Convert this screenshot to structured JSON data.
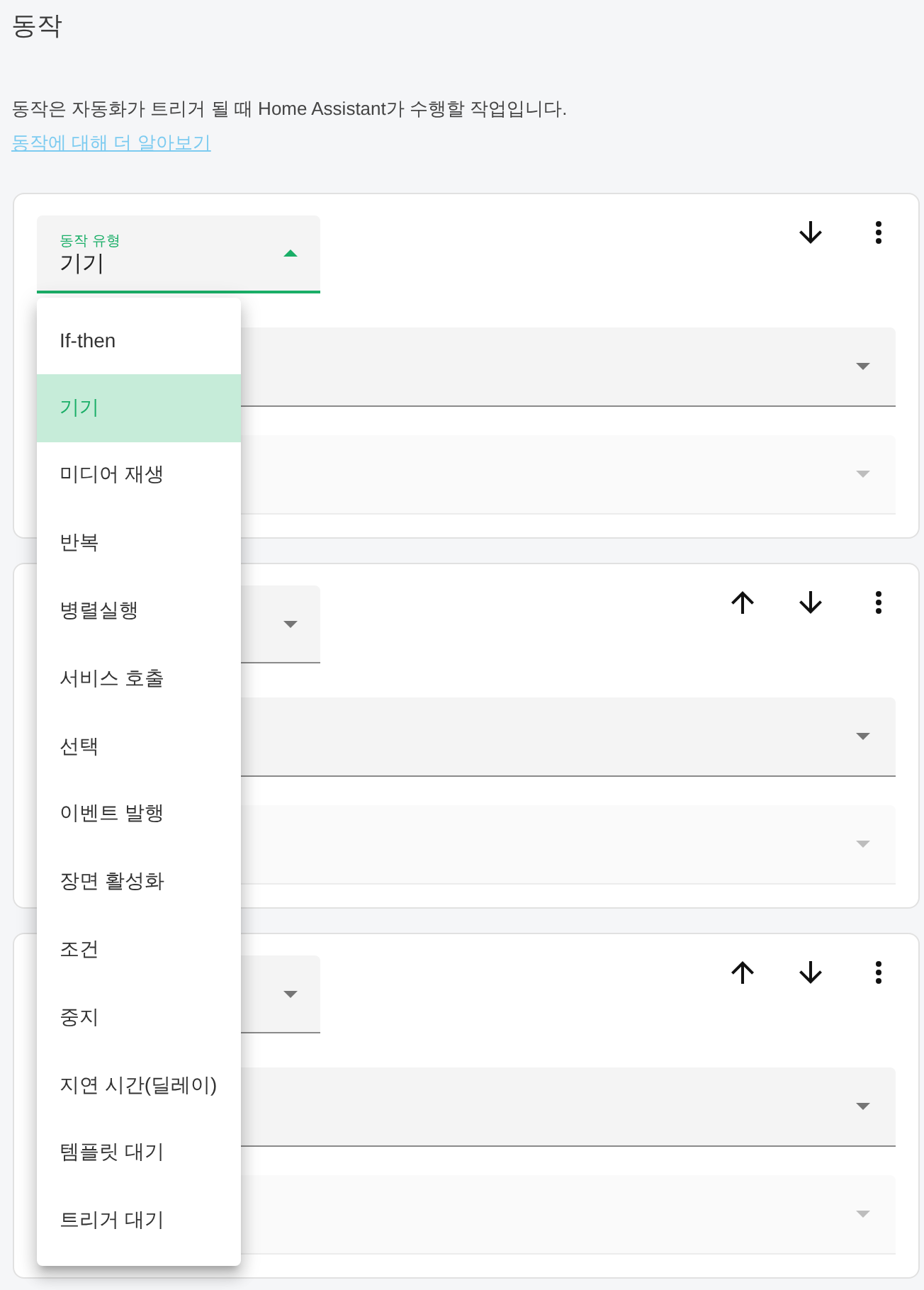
{
  "page": {
    "title": "동작",
    "description": "동작은 자동화가 트리거 될 때 Home Assistant가 수행할 작업입니다.",
    "link": "동작에 대해 더 알아보기"
  },
  "actions": [
    {
      "type_select": {
        "label": "동작 유형",
        "value": "기기",
        "expanded": true
      },
      "move_up": false,
      "move_down": true,
      "fields": [
        {
          "disabled": false
        },
        {
          "disabled": true
        }
      ]
    },
    {
      "type_select": {
        "expanded": false
      },
      "move_up": true,
      "move_down": true,
      "fields": [
        {
          "disabled": false
        },
        {
          "disabled": true
        }
      ]
    },
    {
      "type_select": {
        "expanded": false
      },
      "move_up": true,
      "move_down": true,
      "fields": [
        {
          "disabled": false
        },
        {
          "disabled": true
        }
      ]
    }
  ],
  "type_menu": {
    "items": [
      {
        "label": "If-then",
        "selected": false
      },
      {
        "label": "기기",
        "selected": true
      },
      {
        "label": "미디어 재생",
        "selected": false
      },
      {
        "label": "반복",
        "selected": false
      },
      {
        "label": "병렬실행",
        "selected": false
      },
      {
        "label": "서비스 호출",
        "selected": false
      },
      {
        "label": "선택",
        "selected": false
      },
      {
        "label": "이벤트 발행",
        "selected": false
      },
      {
        "label": "장면 활성화",
        "selected": false
      },
      {
        "label": "조건",
        "selected": false
      },
      {
        "label": "중지",
        "selected": false
      },
      {
        "label": "지연 시간(딜레이)",
        "selected": false
      },
      {
        "label": "템플릿 대기",
        "selected": false
      },
      {
        "label": "트리거 대기",
        "selected": false
      }
    ]
  }
}
